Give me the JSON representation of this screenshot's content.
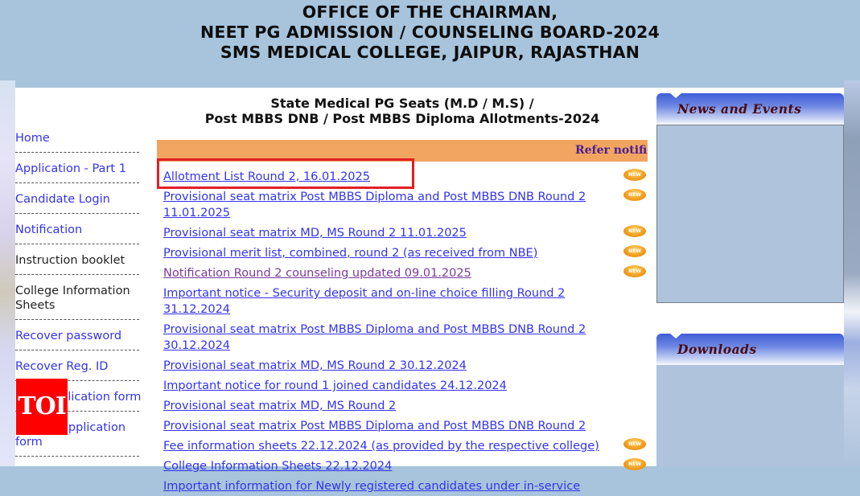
{
  "header": {
    "line1": "OFFICE OF THE CHAIRMAN,",
    "line2": "NEET PG ADMISSION / COUNSELING BOARD-2024",
    "line3": "SMS MEDICAL COLLEGE, JAIPUR, RAJASTHAN"
  },
  "nav": {
    "items": [
      {
        "label": "Home"
      },
      {
        "label": "Application - Part 1"
      },
      {
        "label": "Candidate Login"
      },
      {
        "label": "Notification"
      },
      {
        "label": "Instruction booklet"
      },
      {
        "label": "College Information Sheets"
      },
      {
        "label": "Recover password"
      },
      {
        "label": "Recover Reg. ID"
      },
      {
        "label": "Print application form"
      },
      {
        "label": "Reprint application form"
      }
    ]
  },
  "main": {
    "title_line1": "State Medical PG Seats (M.D / M.S) /",
    "title_line2": "Post MBBS DNB / Post MBBS Diploma Allotments-2024",
    "marquee": "Refer notific:",
    "new_badge_label": "NEW",
    "links": [
      {
        "text": "Allotment List Round 2, 16.01.2025",
        "new": true,
        "highlighted": true
      },
      {
        "text": "Provisional seat matrix Post MBBS Diploma and Post MBBS DNB Round 2 11.01.2025",
        "new": true
      },
      {
        "text": "Provisional seat matrix MD, MS Round 2 11.01.2025",
        "new": true
      },
      {
        "text": "Provisional merit list, combined, round 2 (as received from NBE)",
        "new": true
      },
      {
        "text": "Notification Round 2 counseling updated 09.01.2025",
        "new": true,
        "visited": true
      },
      {
        "text": "Important notice - Security deposit and on-line choice filling Round 2 31.12.2024",
        "new": false
      },
      {
        "text": "Provisional seat matrix Post MBBS Diploma and Post MBBS DNB Round 2 30.12.2024",
        "new": false
      },
      {
        "text": "Provisional seat matrix MD, MS Round 2 30.12.2024",
        "new": false
      },
      {
        "text": "Important notice for round 1 joined candidates 24.12.2024",
        "new": false
      },
      {
        "text": "Provisional seat matrix MD, MS Round 2",
        "new": false
      },
      {
        "text": "Provisional seat matrix Post MBBS Diploma and Post MBBS DNB Round 2",
        "new": false
      },
      {
        "text": "Fee information sheets 22.12.2024 (as provided by the respective college)",
        "new": true
      },
      {
        "text": "College Information Sheets 22.12.2024",
        "new": true
      },
      {
        "text": "Important information for Newly registered candidates under in-service",
        "new": false
      }
    ]
  },
  "sidebar_right": {
    "news_title": "News and Events",
    "downloads_title": "Downloads"
  },
  "watermark": {
    "label": "TOI",
    "color": "#ff0000"
  },
  "colors": {
    "header_bg": "#a7c4dc",
    "link": "#3333ee",
    "visited_link": "#7a3a9a",
    "notice_bar": "#f2a461",
    "highlight_border": "#e31e24",
    "panel_title": "#4a0a14"
  }
}
